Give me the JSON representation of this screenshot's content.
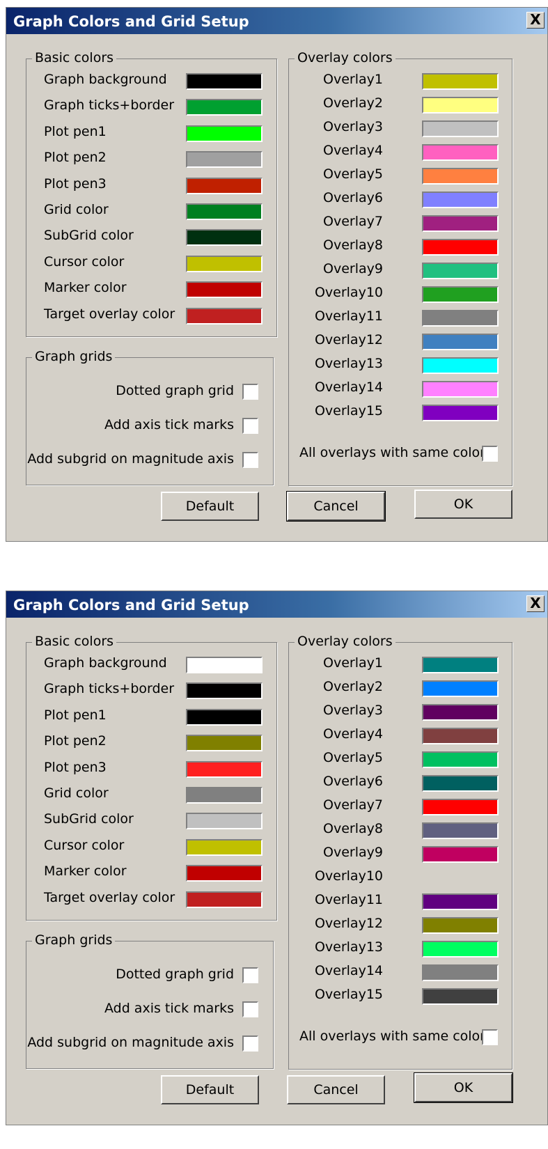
{
  "dialogs": [
    {
      "title": "Graph Colors and Grid Setup",
      "close_label": "X",
      "basic": {
        "legend": "Basic colors",
        "items": [
          {
            "label": "Graph background",
            "color": "#000000"
          },
          {
            "label": "Graph ticks+border",
            "color": "#00a030"
          },
          {
            "label": "Plot pen1",
            "color": "#00ff00"
          },
          {
            "label": "Plot pen2",
            "color": "#a0a0a0"
          },
          {
            "label": "Plot pen3",
            "color": "#c02000"
          },
          {
            "label": "Grid color",
            "color": "#008020"
          },
          {
            "label": "SubGrid color",
            "color": "#003010"
          },
          {
            "label": "Cursor color",
            "color": "#c0c000"
          },
          {
            "label": "Marker color",
            "color": "#c00000"
          },
          {
            "label": "Target overlay color",
            "color": "#c02020"
          }
        ]
      },
      "grids": {
        "legend": "Graph grids",
        "options": [
          {
            "label": "Dotted graph grid",
            "checked": false
          },
          {
            "label": "Add axis tick marks",
            "checked": false
          },
          {
            "label": "Add subgrid on magnitude axis",
            "checked": false
          }
        ]
      },
      "overlays": {
        "legend": "Overlay colors",
        "items": [
          {
            "label": "Overlay1",
            "color": "#c0c000"
          },
          {
            "label": "Overlay2",
            "color": "#ffff80"
          },
          {
            "label": "Overlay3",
            "color": "#c0c0c0"
          },
          {
            "label": "Overlay4",
            "color": "#ff60c0"
          },
          {
            "label": "Overlay5",
            "color": "#ff8040"
          },
          {
            "label": "Overlay6",
            "color": "#8080ff"
          },
          {
            "label": "Overlay7",
            "color": "#a02080"
          },
          {
            "label": "Overlay8",
            "color": "#ff0000"
          },
          {
            "label": "Overlay9",
            "color": "#20c080"
          },
          {
            "label": "Overlay10",
            "color": "#20a020"
          },
          {
            "label": "Overlay11",
            "color": "#808080"
          },
          {
            "label": "Overlay12",
            "color": "#4080c0"
          },
          {
            "label": "Overlay13",
            "color": "#00ffff"
          },
          {
            "label": "Overlay14",
            "color": "#ff80ff"
          },
          {
            "label": "Overlay15",
            "color": "#8000c0"
          }
        ],
        "same_color_label": "All overlays with same color",
        "same_color_checked": false
      },
      "buttons": {
        "default": "Default",
        "cancel": "Cancel",
        "ok": "OK",
        "focused": "cancel"
      }
    },
    {
      "title": "Graph Colors and Grid Setup",
      "close_label": "X",
      "basic": {
        "legend": "Basic colors",
        "items": [
          {
            "label": "Graph background",
            "color": "#ffffff"
          },
          {
            "label": "Graph ticks+border",
            "color": "#000000"
          },
          {
            "label": "Plot pen1",
            "color": "#000000"
          },
          {
            "label": "Plot pen2",
            "color": "#808000"
          },
          {
            "label": "Plot pen3",
            "color": "#ff2020"
          },
          {
            "label": "Grid color",
            "color": "#808080"
          },
          {
            "label": "SubGrid color",
            "color": "#c0c0c0"
          },
          {
            "label": "Cursor color",
            "color": "#c0c000"
          },
          {
            "label": "Marker color",
            "color": "#c00000"
          },
          {
            "label": "Target overlay color",
            "color": "#c02020"
          }
        ]
      },
      "grids": {
        "legend": "Graph grids",
        "options": [
          {
            "label": "Dotted graph grid",
            "checked": false
          },
          {
            "label": "Add axis tick marks",
            "checked": false
          },
          {
            "label": "Add subgrid on magnitude axis",
            "checked": false
          }
        ]
      },
      "overlays": {
        "legend": "Overlay colors",
        "items": [
          {
            "label": "Overlay1",
            "color": "#008080"
          },
          {
            "label": "Overlay2",
            "color": "#0080ff"
          },
          {
            "label": "Overlay3",
            "color": "#600060"
          },
          {
            "label": "Overlay4",
            "color": "#804040"
          },
          {
            "label": "Overlay5",
            "color": "#00c060"
          },
          {
            "label": "Overlay6",
            "color": "#006060"
          },
          {
            "label": "Overlay7",
            "color": "#ff0000"
          },
          {
            "label": "Overlay8",
            "color": "#606080"
          },
          {
            "label": "Overlay9",
            "color": "#c00060"
          },
          {
            "label": "Overlay10",
            "color": null
          },
          {
            "label": "Overlay11",
            "color": "#600080"
          },
          {
            "label": "Overlay12",
            "color": "#808000"
          },
          {
            "label": "Overlay13",
            "color": "#00ff60"
          },
          {
            "label": "Overlay14",
            "color": "#808080"
          },
          {
            "label": "Overlay15",
            "color": "#404040"
          }
        ],
        "same_color_label": "All overlays with same color",
        "same_color_checked": false
      },
      "buttons": {
        "default": "Default",
        "cancel": "Cancel",
        "ok": "OK",
        "focused": "ok"
      }
    }
  ]
}
